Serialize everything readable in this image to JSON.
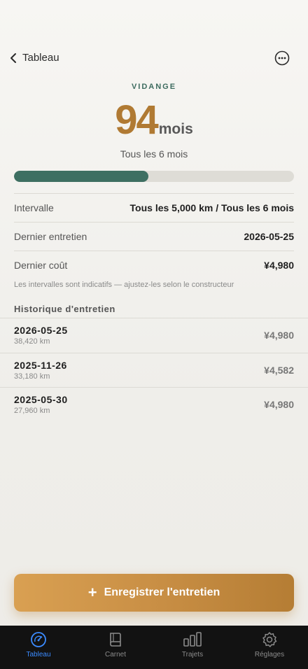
{
  "nav": {
    "back_label": "Tableau",
    "back_icon": "chevron-left-icon",
    "more_icon": "more-icon"
  },
  "header": {
    "category": "VIDANGE",
    "value": "94",
    "unit": "mois",
    "subtitle": "Tous les 6 mois",
    "progress_fraction": 0.48,
    "accent": "#b07a33",
    "bar_color": "#3e6f62"
  },
  "details": [
    {
      "label": "Intervalle",
      "value": "Tous les 5,000 km / Tous les 6 mois"
    },
    {
      "label": "Dernier entretien",
      "value": "2026-05-25"
    },
    {
      "label": "Dernier coût",
      "value": "¥4,980"
    }
  ],
  "note": "Les intervalles sont indicatifs — ajustez-les selon le constructeur",
  "history": {
    "title": "Historique d'entretien",
    "items": [
      {
        "date": "2026-05-25",
        "km": "38,420 km",
        "cost": "¥4,980"
      },
      {
        "date": "2025-11-26",
        "km": "33,180 km",
        "cost": "¥4,582"
      },
      {
        "date": "2025-05-30",
        "km": "27,960 km",
        "cost": "¥4,980"
      }
    ]
  },
  "cta": {
    "icon": "plus-icon",
    "label": "Enregistrer l'entretien"
  },
  "tabbar": {
    "active_color": "#3b8bff",
    "items": [
      {
        "label": "Tableau",
        "icon": "gauge-icon",
        "active": true
      },
      {
        "label": "Carnet",
        "icon": "book-icon",
        "active": false
      },
      {
        "label": "Trajets",
        "icon": "bar-chart-icon",
        "active": false
      },
      {
        "label": "Réglages",
        "icon": "gear-icon",
        "active": false
      }
    ]
  }
}
